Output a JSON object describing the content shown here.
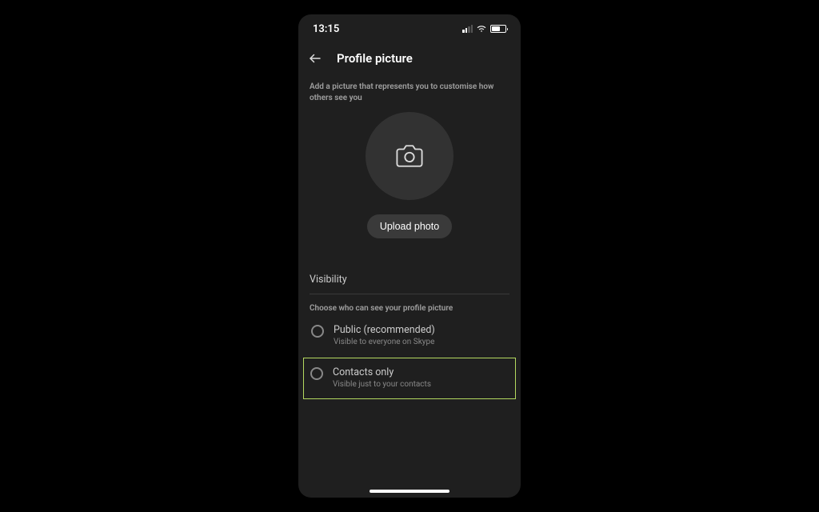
{
  "status": {
    "time": "13:15"
  },
  "header": {
    "title": "Profile picture"
  },
  "main": {
    "subtitle": "Add a picture that represents you to customise how others see you",
    "upload_label": "Upload photo"
  },
  "visibility": {
    "section_label": "Visibility",
    "description": "Choose who can see your profile picture",
    "options": [
      {
        "title": "Public (recommended)",
        "desc": "Visible to everyone on Skype",
        "highlighted": false
      },
      {
        "title": "Contacts only",
        "desc": "Visible just to your contacts",
        "highlighted": true
      }
    ]
  },
  "colors": {
    "highlight_border": "#b4d960",
    "background": "#1f1f1f"
  }
}
